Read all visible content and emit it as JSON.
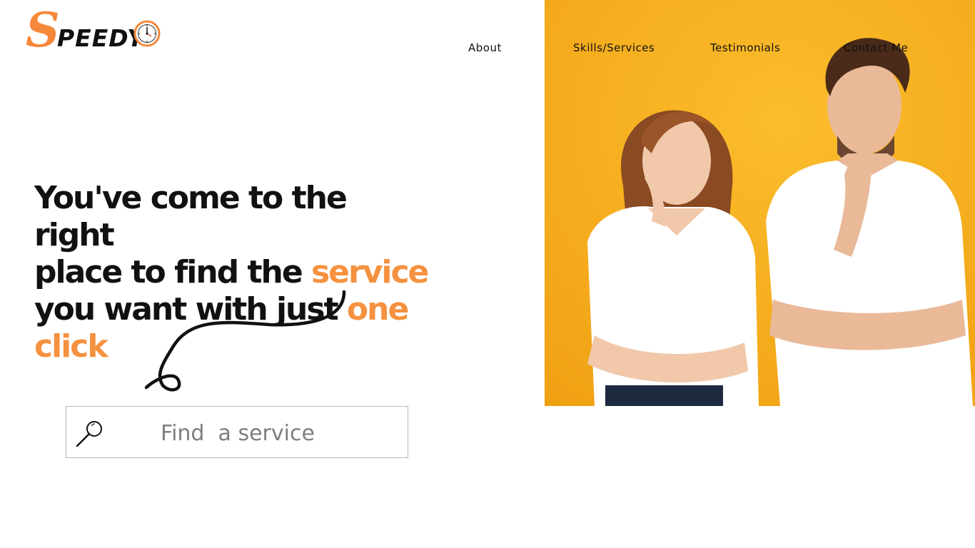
{
  "brand": {
    "logo_letter": "S",
    "logo_rest": "PEEDY",
    "accent_color": "#f5883a"
  },
  "nav": {
    "items": [
      {
        "label": "About"
      },
      {
        "label": "Skills/Services"
      },
      {
        "label": "Testimonials"
      },
      {
        "label": "Contact Me"
      }
    ]
  },
  "hero": {
    "line1": "You've come to the right",
    "line2_pre": "place to find the ",
    "line2_accent": "service",
    "line3_pre": "you want with just ",
    "line3_accent": "one",
    "line4_accent": "click",
    "accent_color": "#f5913f",
    "image_background": "#f5a91c"
  },
  "search": {
    "placeholder": "Find  a service",
    "icon": "magnifier-icon"
  }
}
